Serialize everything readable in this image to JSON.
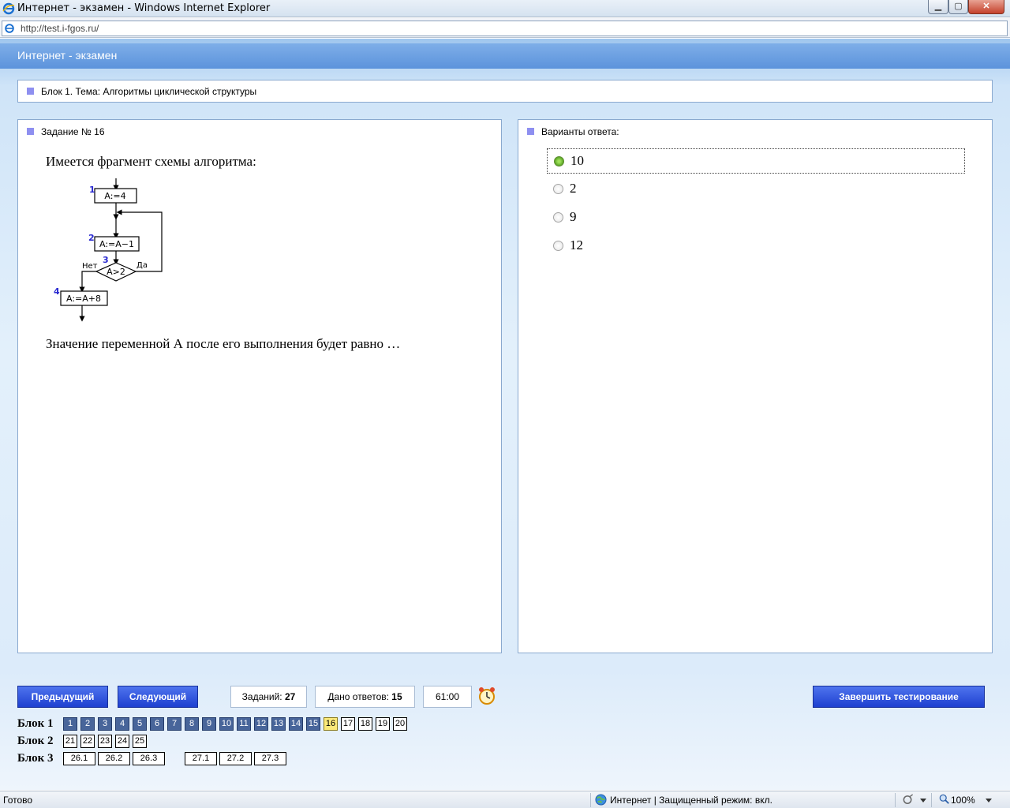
{
  "window": {
    "title": "Интернет - экзамен - Windows Internet Explorer",
    "address": "http://test.i-fgos.ru/"
  },
  "app": {
    "title": "Интернет - экзамен"
  },
  "block_heading": "Блок 1. Тема: Алгоритмы циклической структуры",
  "question": {
    "heading": "Задание № 16",
    "intro": "Имеется фрагмент схемы алгоритма:",
    "outro": "Значение переменной А после его выполнения будет равно …",
    "flowchart": {
      "step_numbers": [
        "1",
        "2",
        "3",
        "4"
      ],
      "box1": "A:=4",
      "box2": "A:=A−1",
      "condition": "A>2",
      "no_label": "Нет",
      "yes_label": "Да",
      "box4": "A:=A+8"
    }
  },
  "answers": {
    "heading": "Варианты ответа:",
    "options": [
      {
        "label": "10",
        "selected": true
      },
      {
        "label": "2",
        "selected": false
      },
      {
        "label": "9",
        "selected": false
      },
      {
        "label": "12",
        "selected": false
      }
    ]
  },
  "controls": {
    "prev": "Предыдущий",
    "next": "Следующий",
    "tasks_label": "Заданий:",
    "tasks_count": "27",
    "given_label": "Дано ответов:",
    "given_count": "15",
    "timer": "61:00",
    "finish": "Завершить тестирование"
  },
  "navigation": {
    "rows": [
      {
        "label": "Блок 1",
        "items": [
          {
            "t": "1",
            "s": "done"
          },
          {
            "t": "2",
            "s": "done"
          },
          {
            "t": "3",
            "s": "done"
          },
          {
            "t": "4",
            "s": "done"
          },
          {
            "t": "5",
            "s": "done"
          },
          {
            "t": "6",
            "s": "done"
          },
          {
            "t": "7",
            "s": "done"
          },
          {
            "t": "8",
            "s": "done"
          },
          {
            "t": "9",
            "s": "done"
          },
          {
            "t": "10",
            "s": "done"
          },
          {
            "t": "11",
            "s": "done"
          },
          {
            "t": "12",
            "s": "done"
          },
          {
            "t": "13",
            "s": "done"
          },
          {
            "t": "14",
            "s": "done"
          },
          {
            "t": "15",
            "s": "done"
          },
          {
            "t": "16",
            "s": "current"
          },
          {
            "t": "17",
            "s": "todo"
          },
          {
            "t": "18",
            "s": "todo"
          },
          {
            "t": "19",
            "s": "todo"
          },
          {
            "t": "20",
            "s": "todo"
          }
        ]
      },
      {
        "label": "Блок 2",
        "items": [
          {
            "t": "21",
            "s": "todo"
          },
          {
            "t": "22",
            "s": "todo"
          },
          {
            "t": "23",
            "s": "todo"
          },
          {
            "t": "24",
            "s": "todo"
          },
          {
            "t": "25",
            "s": "todo"
          }
        ]
      },
      {
        "label": "Блок 3",
        "items": [
          {
            "t": "26.1",
            "s": "todo"
          },
          {
            "t": "26.2",
            "s": "todo"
          },
          {
            "t": "26.3",
            "s": "todo"
          },
          {
            "t": "27.1",
            "s": "todo"
          },
          {
            "t": "27.2",
            "s": "todo"
          },
          {
            "t": "27.3",
            "s": "todo"
          }
        ]
      }
    ]
  },
  "status": {
    "ready": "Готово",
    "zone": "Интернет | Защищенный режим: вкл.",
    "zoom": "100%"
  },
  "colors": {
    "answered": "#48659a",
    "current": "#fbe97a",
    "accent_button": "#2a4ede",
    "selected_radio": "#4f9a1c"
  }
}
